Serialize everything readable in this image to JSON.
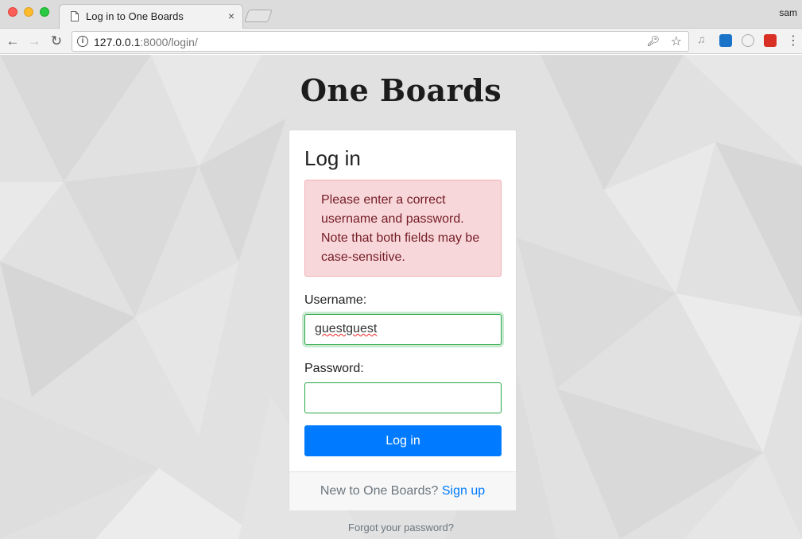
{
  "browser": {
    "tab_title": "Log in to One Boards",
    "tab_close": "×",
    "profile": "sam",
    "url_host": "127.0.0.1",
    "url_rest": ":8000/login/"
  },
  "page": {
    "logo": "One Boards",
    "card_title": "Log in",
    "error": "Please enter a correct username and password. Note that both fields may be case-sensitive.",
    "username_label": "Username:",
    "username_value": "guestguest",
    "password_label": "Password:",
    "password_value": "",
    "submit": "Log in",
    "footer_text": "New to One Boards?",
    "signup_link": "Sign up",
    "forgot_link": "Forgot your password?"
  },
  "colors": {
    "primary": "#007bff",
    "error_bg": "#f8d7da",
    "error_text": "#721c24",
    "valid_border": "#28a745"
  }
}
